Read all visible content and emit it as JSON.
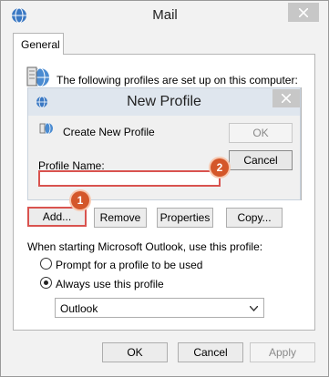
{
  "window": {
    "title": "Mail"
  },
  "tabs": [
    {
      "label": "General"
    }
  ],
  "profiles_label": "The following profiles are set up on this computer:",
  "new_profile_dialog": {
    "title": "New Profile",
    "create_label": "Create New Profile",
    "ok_label": "OK",
    "cancel_label": "Cancel",
    "profile_name_label": "Profile Name:",
    "profile_name_value": ""
  },
  "badges": [
    "1",
    "2"
  ],
  "buttons": {
    "add": "Add...",
    "remove": "Remove",
    "properties": "Properties",
    "copy": "Copy..."
  },
  "startup": {
    "label": "When starting Microsoft Outlook, use this profile:",
    "options": [
      {
        "label": "Prompt for a profile to be used",
        "selected": false
      },
      {
        "label": "Always use this profile",
        "selected": true
      }
    ],
    "selected_profile": "Outlook"
  },
  "footer": {
    "ok": "OK",
    "cancel": "Cancel",
    "apply": "Apply"
  },
  "colors": {
    "highlight": "#d9534f",
    "badge": "#d4572a",
    "dialog_title_bg": "#dfe6ee"
  }
}
